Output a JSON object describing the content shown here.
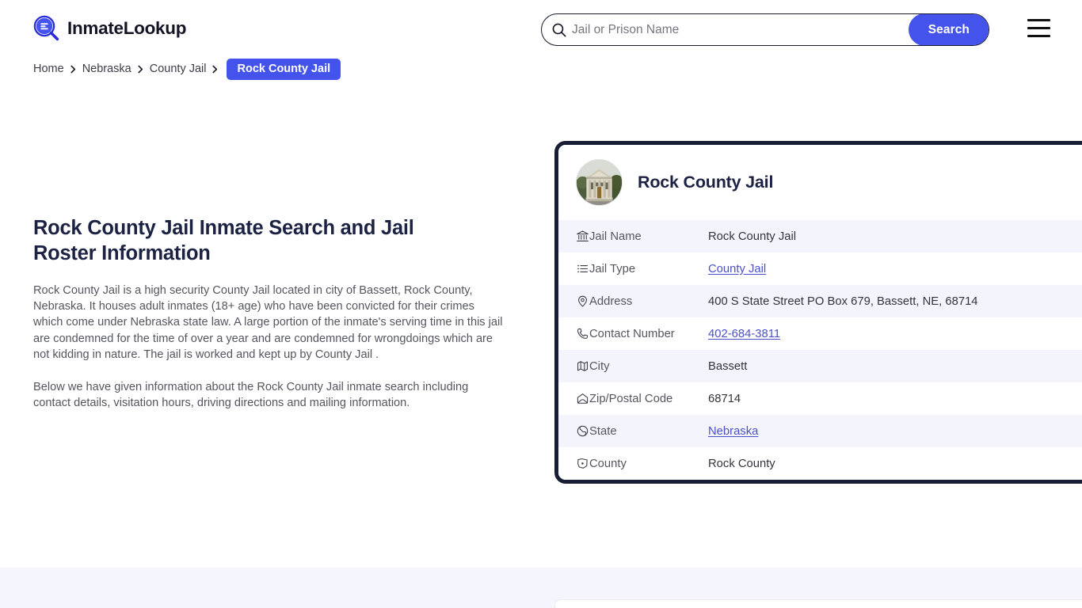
{
  "header": {
    "brand_name": "InmateLookup",
    "brand_icon": "magnifier-list-icon",
    "search": {
      "placeholder": "Jail or Prison Name",
      "value": "",
      "button_label": "Search",
      "icon": "search-icon"
    },
    "menu_icon": "hamburger-menu-icon",
    "accent_color": "#4353ec"
  },
  "breadcrumb": {
    "items": [
      {
        "label": "Home",
        "current": false
      },
      {
        "label": "Nebraska",
        "current": false
      },
      {
        "label": "County Jail",
        "current": false
      },
      {
        "label": "Rock County Jail",
        "current": true
      }
    ],
    "separator": "›"
  },
  "main": {
    "title": "Rock County Jail Inmate Search and Jail Roster Information",
    "paragraph_1": "Rock County Jail is a high security County Jail located in city of Bassett, Rock County, Nebraska. It houses adult inmates (18+ age) who have been convicted for their crimes which come under Nebraska state law. A large portion of the inmate's serving time in this jail are condemned for the time of over a year and are condemned for wrongdoings which are not kidding in nature. The jail is worked and kept up by County Jail .",
    "paragraph_2": "Below we have given information about the Rock County Jail inmate search including contact details, visitation hours, driving directions and mailing information."
  },
  "info_card": {
    "avatar_icon": "courthouse-photo",
    "title": "Rock County Jail",
    "rows": [
      {
        "icon": "bank-icon",
        "label": "Jail Name",
        "value": "Rock County Jail",
        "link": false
      },
      {
        "icon": "list-icon",
        "label": "Jail Type",
        "value": "County Jail",
        "link": true
      },
      {
        "icon": "map-pin-icon",
        "label": "Address",
        "value": "400 S State Street PO Box 679, Bassett, NE, 68714",
        "link": false
      },
      {
        "icon": "phone-icon",
        "label": "Contact Number",
        "value": "402-684-3811",
        "link": true
      },
      {
        "icon": "map-icon",
        "label": "City",
        "value": "Bassett",
        "link": false
      },
      {
        "icon": "envelope-icon",
        "label": "Zip/Postal Code",
        "value": "68714",
        "link": false
      },
      {
        "icon": "globe-icon",
        "label": "State",
        "value": "Nebraska",
        "link": true
      },
      {
        "icon": "county-icon",
        "label": "County",
        "value": "Rock County",
        "link": false
      }
    ]
  }
}
